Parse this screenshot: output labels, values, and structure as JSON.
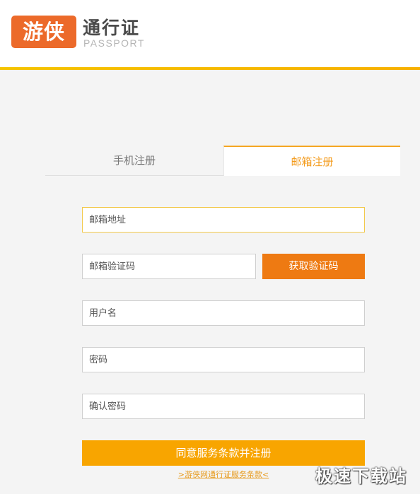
{
  "header": {
    "logo_badge": "游侠",
    "logo_title": "通行证",
    "logo_subtitle": "PASSPORT"
  },
  "tabs": [
    {
      "label": "手机注册",
      "active": false
    },
    {
      "label": "邮箱注册",
      "active": true
    }
  ],
  "form": {
    "email_placeholder": "邮箱地址",
    "email_code_placeholder": "邮箱验证码",
    "get_code_label": "获取验证码",
    "username_placeholder": "用户名",
    "password_placeholder": "密码",
    "confirm_password_placeholder": "确认密码",
    "submit_label": "同意服务条款并注册",
    "terms_link": ">游侠网通行证服务条款<"
  },
  "watermark": "极速下载站",
  "colors": {
    "accent_orange": "#ee7a12",
    "submit_yellow": "#f8a500",
    "tab_active_text": "#f39a1a",
    "header_line": "#f5b800",
    "logo_badge": "#ec6a2a"
  }
}
